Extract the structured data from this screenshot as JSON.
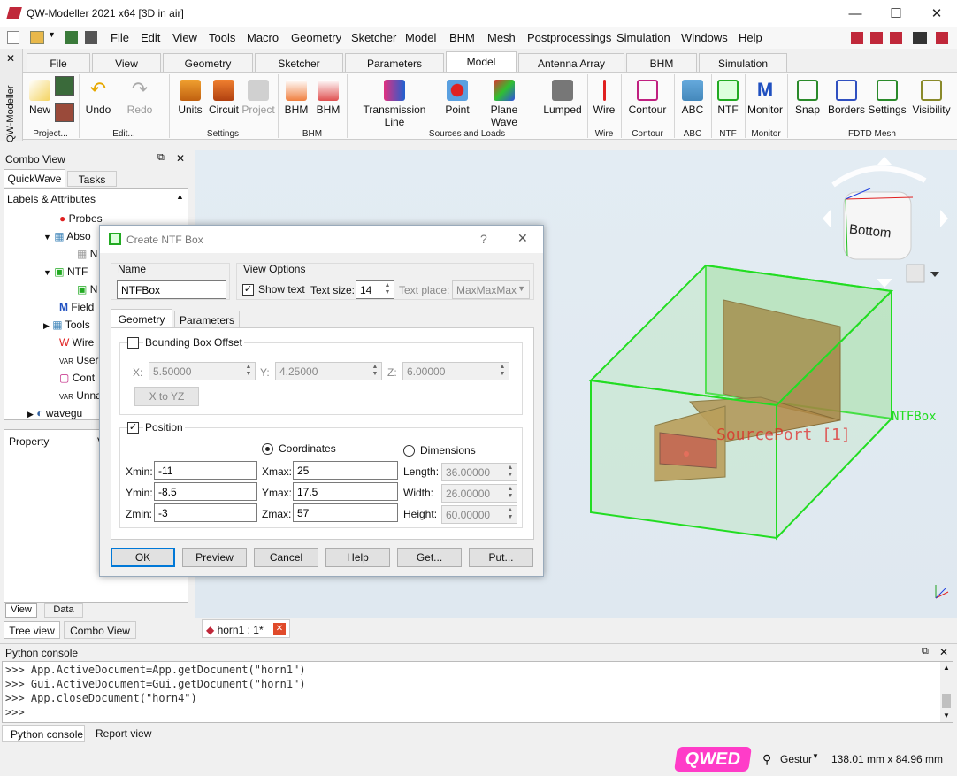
{
  "window": {
    "title": "QW-Modeller 2021 x64 [3D in air]",
    "minimize": "—",
    "maximize": "☐",
    "close": "✕"
  },
  "menu": [
    "File",
    "Edit",
    "View",
    "Tools",
    "Macro",
    "Geometry",
    "Sketcher",
    "Model",
    "BHM",
    "Mesh",
    "Postprocessings",
    "Simulation",
    "Windows",
    "Help"
  ],
  "side_label": "QW-Modeller",
  "tabs": [
    "File",
    "View",
    "Geometry",
    "Sketcher",
    "Parameters",
    "Model",
    "Antenna Array",
    "BHM",
    "Simulation"
  ],
  "active_tab": "Model",
  "ribbon": {
    "buttons": {
      "new": "New",
      "undo": "Undo",
      "redo": "Redo",
      "units": "Units",
      "circuit": "Circuit",
      "project": "Project",
      "bhm1": "BHM",
      "bhm2": "BHM",
      "transmission_line": "Transmission Line",
      "point": "Point",
      "plane_wave": "Plane Wave",
      "lumped": "Lumped",
      "wire": "Wire",
      "contour": "Contour",
      "abc": "ABC",
      "ntf": "NTF",
      "monitor": "Monitor",
      "snap": "Snap",
      "borders": "Borders",
      "settings": "Settings",
      "visibility": "Visibility"
    },
    "groups": {
      "project": "Project...",
      "edit": "Edit...",
      "settings": "Settings",
      "bhm": "BHM",
      "sources": "Sources and Loads",
      "wire": "Wire",
      "contour": "Contour",
      "abc": "ABC",
      "ntf": "NTF",
      "monitor": "Monitor",
      "fdtd": "FDTD Mesh"
    }
  },
  "combo_view": {
    "title": "Combo View",
    "tabs": [
      "QuickWave",
      "Tasks"
    ],
    "section": "Labels & Attributes",
    "tree": [
      "Probes",
      "Abso",
      "N",
      "NTF",
      "N",
      "Field",
      "Tools",
      "Wire",
      "User",
      "Cont",
      "Unna",
      "wavegu"
    ],
    "property_header": "Property",
    "value_header": "V",
    "bottom_tabs": [
      "View",
      "Data"
    ],
    "panel_tabs": [
      "Tree view",
      "Combo View"
    ]
  },
  "viewport": {
    "nav_cube_face": "Bottom",
    "label_ntf": "NTFBox",
    "label_source": "SourcePort [1]",
    "doc_tab": "horn1 : 1*"
  },
  "dialog": {
    "title": "Create NTF Box",
    "help": "?",
    "close": "✕",
    "name_group": "Name",
    "name_value": "NTFBox",
    "view_options": "View Options",
    "show_text": "Show text",
    "text_size_label": "Text size:",
    "text_size": "14",
    "text_place_label": "Text place:",
    "text_place": "MaxMaxMax",
    "tabs": [
      "Geometry",
      "Parameters"
    ],
    "bbox_offset": "Bounding Box Offset",
    "x_label": "X:",
    "x_value": "5.50000",
    "y_label": "Y:",
    "y_value": "4.25000",
    "z_label": "Z:",
    "z_value": "6.00000",
    "x_to_yz": "X to YZ",
    "position": "Position",
    "coordinates": "Coordinates",
    "dimensions": "Dimensions",
    "xmin_label": "Xmin:",
    "xmin": "-11",
    "ymin_label": "Ymin:",
    "ymin": "-8.5",
    "zmin_label": "Zmin:",
    "zmin": "-3",
    "xmax_label": "Xmax:",
    "xmax": "25",
    "ymax_label": "Ymax:",
    "ymax": "17.5",
    "zmax_label": "Zmax:",
    "zmax": "57",
    "length_label": "Length:",
    "length": "36.00000",
    "width_label": "Width:",
    "width": "26.00000",
    "height_label": "Height:",
    "height": "60.00000",
    "buttons": {
      "ok": "OK",
      "preview": "Preview",
      "cancel": "Cancel",
      "help": "Help",
      "get": "Get...",
      "put": "Put..."
    }
  },
  "console": {
    "title": "Python console",
    "lines": [
      ">>> App.ActiveDocument=App.getDocument(\"horn1\")",
      ">>> Gui.ActiveDocument=Gui.getDocument(\"horn1\")",
      ">>> App.closeDocument(\"horn4\")",
      ">>>"
    ],
    "tabs": [
      "Python console",
      "Report view"
    ]
  },
  "status": {
    "logo": "QWED",
    "nav_style": "Gestur",
    "dimensions": "138.01 mm x 84.96 mm"
  },
  "colors": {
    "accent": "#0078d7",
    "ntf_box": "#22dd22",
    "horn": "#b5651d",
    "port": "#e02020"
  }
}
